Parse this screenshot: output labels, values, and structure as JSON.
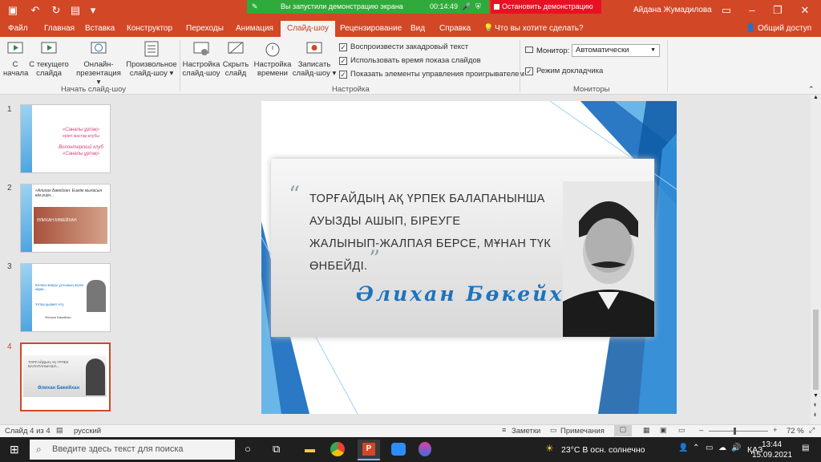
{
  "share": {
    "message": "Вы запустили демонстрацию экрана",
    "timer": "00:14:49",
    "stop_label": "Остановить демонстрацию"
  },
  "user": {
    "name": "Айдана Жумадилова"
  },
  "tabs": [
    "Файл",
    "Главная",
    "Вставка",
    "Конструктор",
    "Переходы",
    "Анимация",
    "Слайд-шоу",
    "Рецензирование",
    "Вид",
    "Справка"
  ],
  "search_hint": "Что вы хотите сделать?",
  "share_button": "Общий доступ",
  "ribbon": {
    "buttons": [
      {
        "l1": "С",
        "l2": "начала"
      },
      {
        "l1": "С текущего",
        "l2": "слайда"
      },
      {
        "l1": "Онлайн-",
        "l2": "презентация ▾"
      },
      {
        "l1": "Произвольное",
        "l2": "слайд-шоу ▾"
      },
      {
        "l1": "Настройка",
        "l2": "слайд-шоу"
      },
      {
        "l1": "Скрыть",
        "l2": "слайд"
      },
      {
        "l1": "Настройка",
        "l2": "времени"
      },
      {
        "l1": "Записать",
        "l2": "слайд-шоу ▾"
      }
    ],
    "checks": [
      "Воспроизвести закадровый текст",
      "Использовать время показа слайдов",
      "Показать элементы управления проигрывателем"
    ],
    "monitor_label": "Монитор:",
    "monitor_value": "Автоматически",
    "presenter_view": "Режим докладчика",
    "groups": [
      "Начать слайд-шоу",
      "Настройка",
      "Мониторы"
    ]
  },
  "thumbs": [
    {
      "num": "1",
      "t1": "«Саналы ұрпақ»",
      "t2": "ерікті жастар клубы",
      "t3": "Волонтерский клуб",
      "t4": "«Саналы ұрпақ»"
    },
    {
      "num": "2",
      "t1": "«Алихан Бөкейхан: Ешкім жыласын кім-ушін...",
      "t2": "ӘЛИХАН БӨКЕЙХАН"
    },
    {
      "num": "3",
      "t1": "Кеткен жақсы ұлтының жүзін көрм...",
      "t2": "Ұлтқа қызмет ету",
      "t3": "Әлихан Бөкейхан"
    },
    {
      "num": "4",
      "t1": "ТОРҒАЙДЫҢ АҚ ҮРПЕК БАЛАПАНЫНША...",
      "t2": "Әлихан Бөкейхан"
    }
  ],
  "slide": {
    "quote_lines": [
      "ТОРҒАЙДЫҢ АҚ ҮРПЕК БАЛАПАНЫНША",
      "АУЫЗДЫ АШЫП, БІРЕУГЕ",
      "ЖАЛЫНЫП-ЖАЛПАЯ БЕРСЕ, МҰНАН ТҮК",
      "ӨНБЕЙДІ."
    ],
    "author": "Әлихан Бөкейхан",
    "accent": "#1e73be"
  },
  "status": {
    "slide": "Слайд 4 из 4",
    "lang": "русский",
    "notes": "Заметки",
    "comments": "Примечания",
    "zoom": "72 %"
  },
  "taskbar": {
    "search": "Введите здесь текст для поиска",
    "weather": "23°C  В осн. солнечно",
    "lang": "ҚАЗ",
    "time": "13:44",
    "date": "15.09.2021"
  }
}
